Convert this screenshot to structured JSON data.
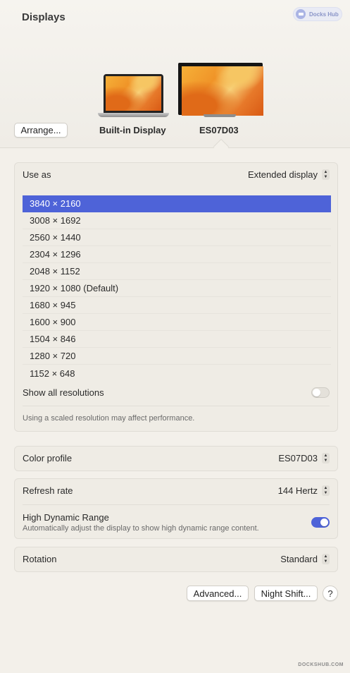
{
  "window": {
    "title": "Displays"
  },
  "badge": {
    "label": "Docks Hub"
  },
  "arrangement": {
    "arrange_button": "Arrange...",
    "displays": [
      {
        "label": "Built-in Display",
        "selected": false
      },
      {
        "label": "ES07D03",
        "selected": true
      }
    ]
  },
  "use_as": {
    "label": "Use as",
    "value": "Extended display"
  },
  "resolutions": {
    "items": [
      "3840 × 2160",
      "3008 × 1692",
      "2560 × 1440",
      "2304 × 1296",
      "2048 × 1152",
      "1920 × 1080 (Default)",
      "1680 × 945",
      "1600 × 900",
      "1504 × 846",
      "1280 × 720",
      "1152 × 648"
    ],
    "selected_index": 0,
    "show_all_label": "Show all resolutions",
    "show_all_on": false,
    "note": "Using a scaled resolution may affect performance."
  },
  "color_profile": {
    "label": "Color profile",
    "value": "ES07D03"
  },
  "refresh_rate": {
    "label": "Refresh rate",
    "value": "144 Hertz"
  },
  "hdr": {
    "label": "High Dynamic Range",
    "description": "Automatically adjust the display to show high dynamic range content.",
    "on": true
  },
  "rotation": {
    "label": "Rotation",
    "value": "Standard"
  },
  "footer": {
    "advanced_button": "Advanced...",
    "night_shift_button": "Night Shift...",
    "help_button": "?"
  },
  "watermark": "DOCKSHUB.COM",
  "colors": {
    "accent": "#4e63d8",
    "background": "#f3f0ea"
  }
}
